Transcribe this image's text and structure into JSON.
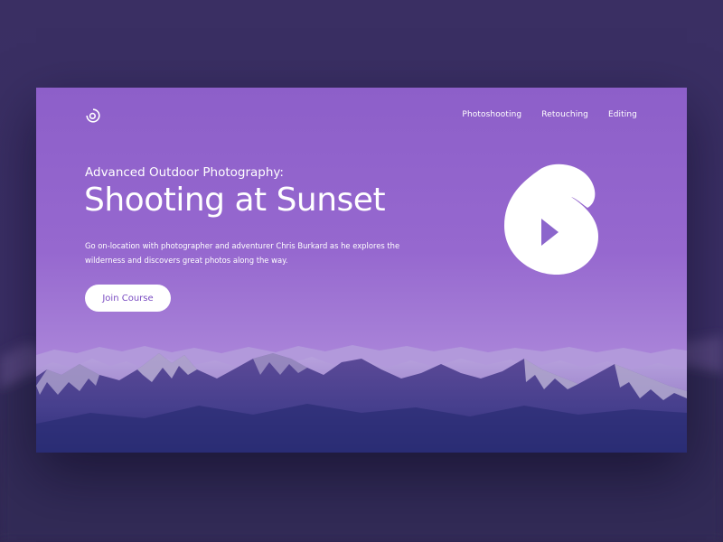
{
  "nav": {
    "items": [
      {
        "label": "Photoshooting"
      },
      {
        "label": "Retouching"
      },
      {
        "label": "Editing"
      }
    ]
  },
  "hero": {
    "subtitle": "Advanced Outdoor Photography:",
    "title": "Shooting at Sunset",
    "description": "Go on-location with photographer and adventurer Chris Burkard as he explores the wilderness and discovers great photos along the way.",
    "cta_label": "Join Course"
  },
  "icons": {
    "logo": "ring-logo-icon",
    "play": "play-icon"
  },
  "colors": {
    "background": "#352b58",
    "hero_top": "#8d5fc9",
    "accent_text": "#7a4cc2",
    "mountains_dark": "#3c3a86"
  }
}
